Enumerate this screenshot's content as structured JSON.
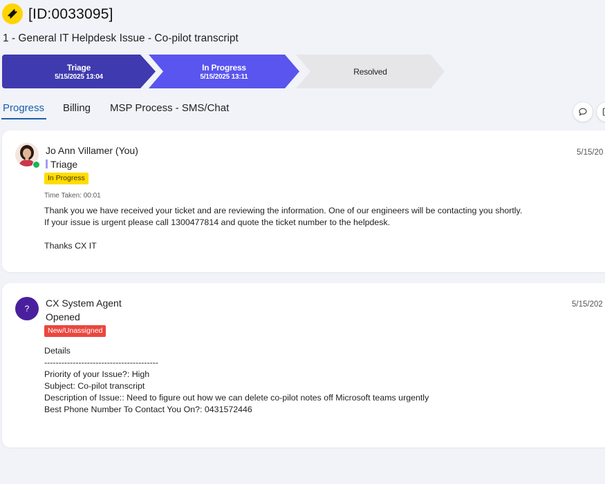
{
  "ticket": {
    "id_label": "[ID:0033095]",
    "title": "1 - General IT Helpdesk Issue - Co-pilot transcript"
  },
  "stages": [
    {
      "name": "Triage",
      "date": "5/15/2025 13:04"
    },
    {
      "name": "In Progress",
      "date": "5/15/2025 13:11"
    },
    {
      "name": "Resolved",
      "date": ""
    }
  ],
  "tabs": [
    {
      "label": "Progress",
      "active": true
    },
    {
      "label": "Billing",
      "active": false
    },
    {
      "label": "MSP Process - SMS/Chat",
      "active": false
    }
  ],
  "entries": [
    {
      "author": "Jo Ann Villamer (You)",
      "status": "Triage",
      "badge": "In Progress",
      "time_taken": "Time Taken: 00:01",
      "date": "5/15/20",
      "body_line1": "Thank you we have received your ticket and are reviewing the information. One of our engineers will be contacting you shortly.",
      "body_line2": "If your issue is urgent please call 1300477814 and quote the ticket number to the helpdesk.",
      "body_line3": "Thanks CX IT"
    },
    {
      "author": "CX System Agent",
      "avatar_letter": "?",
      "status": "Opened",
      "badge": "New/Unassigned",
      "date": "5/15/202",
      "details_heading": "Details",
      "details_rule": "----------------------------------------",
      "details_lines": [
        "Priority of your Issue?: High",
        "Subject: Co-pilot transcript",
        "Description of Issue:: Need to figure out how we can delete co-pilot notes off Microsoft teams urgently",
        "Best Phone Number To Contact You On?: 0431572446"
      ]
    }
  ],
  "icons": {
    "ticket": "ticket-icon",
    "comment": "comment-icon",
    "document": "document-icon"
  },
  "colors": {
    "stage_triage": "#3f3aaf",
    "stage_in_progress": "#5955ee",
    "stage_resolved": "#e6e6e8",
    "badge_in_progress": "#ffdc00",
    "badge_new": "#e9473f",
    "accent": "#1a5fa8"
  }
}
